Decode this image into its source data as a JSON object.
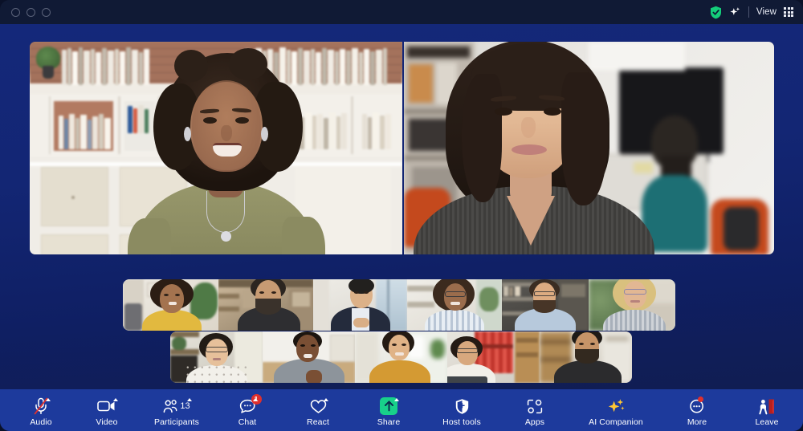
{
  "window": {
    "traffic_lights": [
      "close",
      "minimize",
      "maximize"
    ]
  },
  "titlebar": {
    "encryption_icon": "shield-check-icon",
    "ai_icon": "sparkle-icon",
    "view_label": "View",
    "view_layout_icon": "grid-view-icon"
  },
  "stage": {
    "speakers": [
      {
        "id": "speaker-1",
        "description": "Woman with curly hair in olive t-shirt in front of white bookshelf"
      },
      {
        "id": "speaker-2",
        "description": "Woman with dark bob hair in grey knit top in an office"
      }
    ],
    "filmstrip": {
      "row1": [
        {
          "id": "thumb-1",
          "description": "Woman in yellow top with plants"
        },
        {
          "id": "thumb-2",
          "description": "Bearded man in dark tee in loft kitchen"
        },
        {
          "id": "thumb-3",
          "description": "Man in navy blazer by a window"
        },
        {
          "id": "thumb-4",
          "description": "Woman with glasses and curly hair in striped shirt"
        },
        {
          "id": "thumb-5",
          "description": "Man in light blue shirt with bookshelves"
        },
        {
          "id": "thumb-6",
          "description": "Blonde woman with glasses on a sofa"
        }
      ],
      "row2": [
        {
          "id": "thumb-7",
          "description": "Woman with glasses and white polka top"
        },
        {
          "id": "thumb-8",
          "description": "Man in grey shirt gesturing at a table"
        },
        {
          "id": "thumb-9",
          "description": "Woman in mustard top in a bright kitchen"
        },
        {
          "id": "thumb-10",
          "description": "Woman with glasses at a laptop, red wall"
        },
        {
          "id": "thumb-11",
          "description": "Bearded man in black tee with wood shelving"
        }
      ]
    }
  },
  "toolbar": {
    "left": [
      {
        "id": "audio",
        "label": "Audio",
        "icon": "microphone-muted-icon",
        "muted": true,
        "caret": true
      },
      {
        "id": "video",
        "label": "Video",
        "icon": "video-camera-icon",
        "caret": true
      }
    ],
    "center": [
      {
        "id": "participants",
        "label": "Participants",
        "icon": "participants-icon",
        "count": "13",
        "caret": true
      },
      {
        "id": "chat",
        "label": "Chat",
        "icon": "chat-bubble-icon",
        "badge": "1",
        "caret": true
      },
      {
        "id": "react",
        "label": "React",
        "icon": "heart-icon",
        "caret": true
      },
      {
        "id": "share",
        "label": "Share",
        "icon": "share-screen-icon",
        "caret": true
      },
      {
        "id": "host-tools",
        "label": "Host tools",
        "icon": "shield-icon"
      },
      {
        "id": "apps",
        "label": "Apps",
        "icon": "apps-icon"
      },
      {
        "id": "ai-companion",
        "label": "AI Companion",
        "icon": "sparkle-icon"
      },
      {
        "id": "more",
        "label": "More",
        "icon": "more-ellipsis-icon",
        "dot": true
      }
    ],
    "right": [
      {
        "id": "leave",
        "label": "Leave",
        "icon": "leave-door-icon"
      }
    ]
  },
  "colors": {
    "titlebar_bg": "#101a35",
    "stage_top": "#14287a",
    "stage_bottom": "#101d52",
    "toolbar_bg": "#1d3a9c",
    "accent_green": "#18d08a",
    "badge_red": "#e0302d",
    "ai_gold": "#ffc733",
    "leave_red": "#e0302d"
  }
}
